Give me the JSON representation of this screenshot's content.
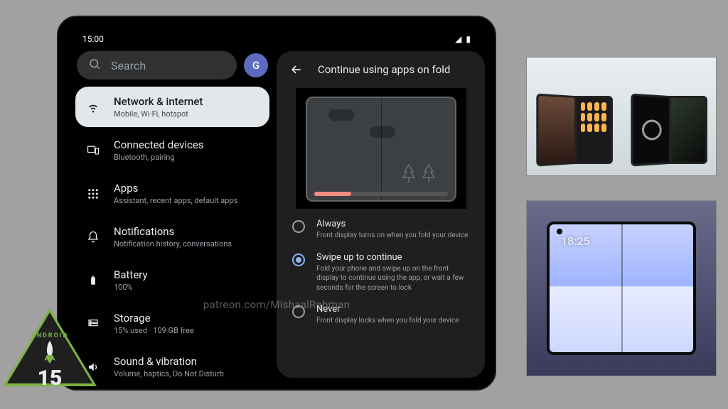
{
  "status": {
    "time": "15:00"
  },
  "search": {
    "placeholder": "Search",
    "avatar_initial": "G"
  },
  "menu": [
    {
      "key": "network",
      "icon": "wifi",
      "title": "Network & internet",
      "sub": "Mobile, Wi-Fi, hotspot",
      "selected": true
    },
    {
      "key": "connected",
      "icon": "devices",
      "title": "Connected devices",
      "sub": "Bluetooth, pairing"
    },
    {
      "key": "apps",
      "icon": "apps",
      "title": "Apps",
      "sub": "Assistant, recent apps, default apps"
    },
    {
      "key": "notif",
      "icon": "bell",
      "title": "Notifications",
      "sub": "Notification history, conversations"
    },
    {
      "key": "battery",
      "icon": "battery",
      "title": "Battery",
      "sub": "100%"
    },
    {
      "key": "storage",
      "icon": "storage",
      "title": "Storage",
      "sub": "15% used · 109 GB free"
    },
    {
      "key": "sound",
      "icon": "volume",
      "title": "Sound & vibration",
      "sub": "Volume, haptics, Do Not Disturb"
    }
  ],
  "detail": {
    "title": "Continue using apps on fold",
    "options": [
      {
        "key": "always",
        "title": "Always",
        "sub": "Front display turns on when you fold your device",
        "selected": false
      },
      {
        "key": "swipe",
        "title": "Swipe up to continue",
        "sub": "Fold your phone and swipe up on the front display to continue using the app, or wait a few seconds for the screen to lock",
        "selected": true
      },
      {
        "key": "never",
        "title": "Never",
        "sub": "Front display locks when you fold your device",
        "selected": false
      }
    ]
  },
  "watermark": "patreon.com/MishaalRahman",
  "badge": {
    "label": "ANDROID",
    "version": "15"
  },
  "photo2": {
    "clock": "18:25"
  }
}
